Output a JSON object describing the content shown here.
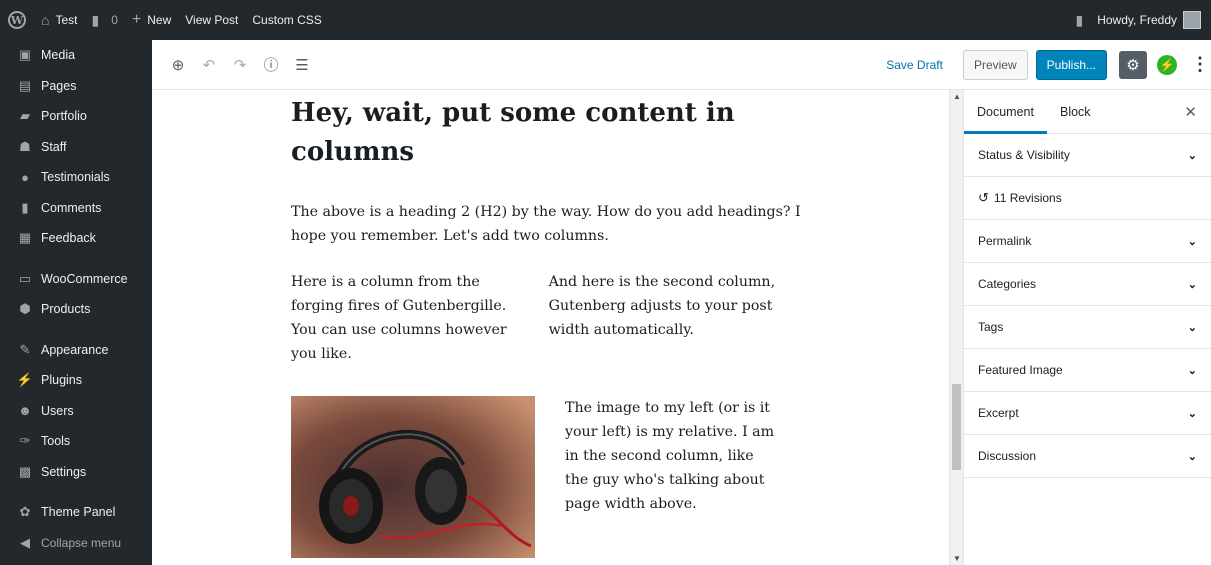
{
  "adminbar": {
    "site_name": "Test",
    "comments_count": "0",
    "new_label": "New",
    "view_post": "View Post",
    "custom_css": "Custom CSS",
    "howdy": "Howdy, Freddy"
  },
  "menu": {
    "items": [
      {
        "label": "Media",
        "icon": "media-icon"
      },
      {
        "label": "Pages",
        "icon": "pages-icon"
      },
      {
        "label": "Portfolio",
        "icon": "portfolio-icon"
      },
      {
        "label": "Staff",
        "icon": "staff-icon"
      },
      {
        "label": "Testimonials",
        "icon": "testimonials-icon"
      },
      {
        "label": "Comments",
        "icon": "comments-icon"
      },
      {
        "label": "Feedback",
        "icon": "feedback-icon"
      },
      {
        "label": "WooCommerce",
        "icon": "woocommerce-icon"
      },
      {
        "label": "Products",
        "icon": "products-icon"
      },
      {
        "label": "Appearance",
        "icon": "appearance-icon"
      },
      {
        "label": "Plugins",
        "icon": "plugins-icon"
      },
      {
        "label": "Users",
        "icon": "users-icon"
      },
      {
        "label": "Tools",
        "icon": "tools-icon"
      },
      {
        "label": "Settings",
        "icon": "settings-icon"
      },
      {
        "label": "Theme Panel",
        "icon": "theme-panel-icon"
      }
    ],
    "collapse": "Collapse menu"
  },
  "toolbar": {
    "save_draft": "Save Draft",
    "preview": "Preview",
    "publish": "Publish..."
  },
  "content": {
    "heading": "Hey, wait, put some content in columns",
    "paragraph": "The above is a heading 2 (H2) by the way. How do you add headings? I hope you remember. Let's add two columns.",
    "col1": "Here is a column from the forging fires of Gutenbergille. You can use columns however you like.",
    "col2": "And here is the second column, Gutenberg adjusts to your post width automatically.",
    "col4": "The image to my left (or is it your left) is my relative. I am in the second column, like the guy who's talking about page width above."
  },
  "sidebar": {
    "tab_document": "Document",
    "tab_block": "Block",
    "panels": {
      "status": "Status & Visibility",
      "revisions": "11 Revisions",
      "permalink": "Permalink",
      "categories": "Categories",
      "tags": "Tags",
      "featured": "Featured Image",
      "excerpt": "Excerpt",
      "discussion": "Discussion"
    }
  },
  "colors": {
    "admin_dark": "#23282d",
    "accent": "#0085ba",
    "link": "#0073aa",
    "jetpack": "#2fb41f"
  }
}
